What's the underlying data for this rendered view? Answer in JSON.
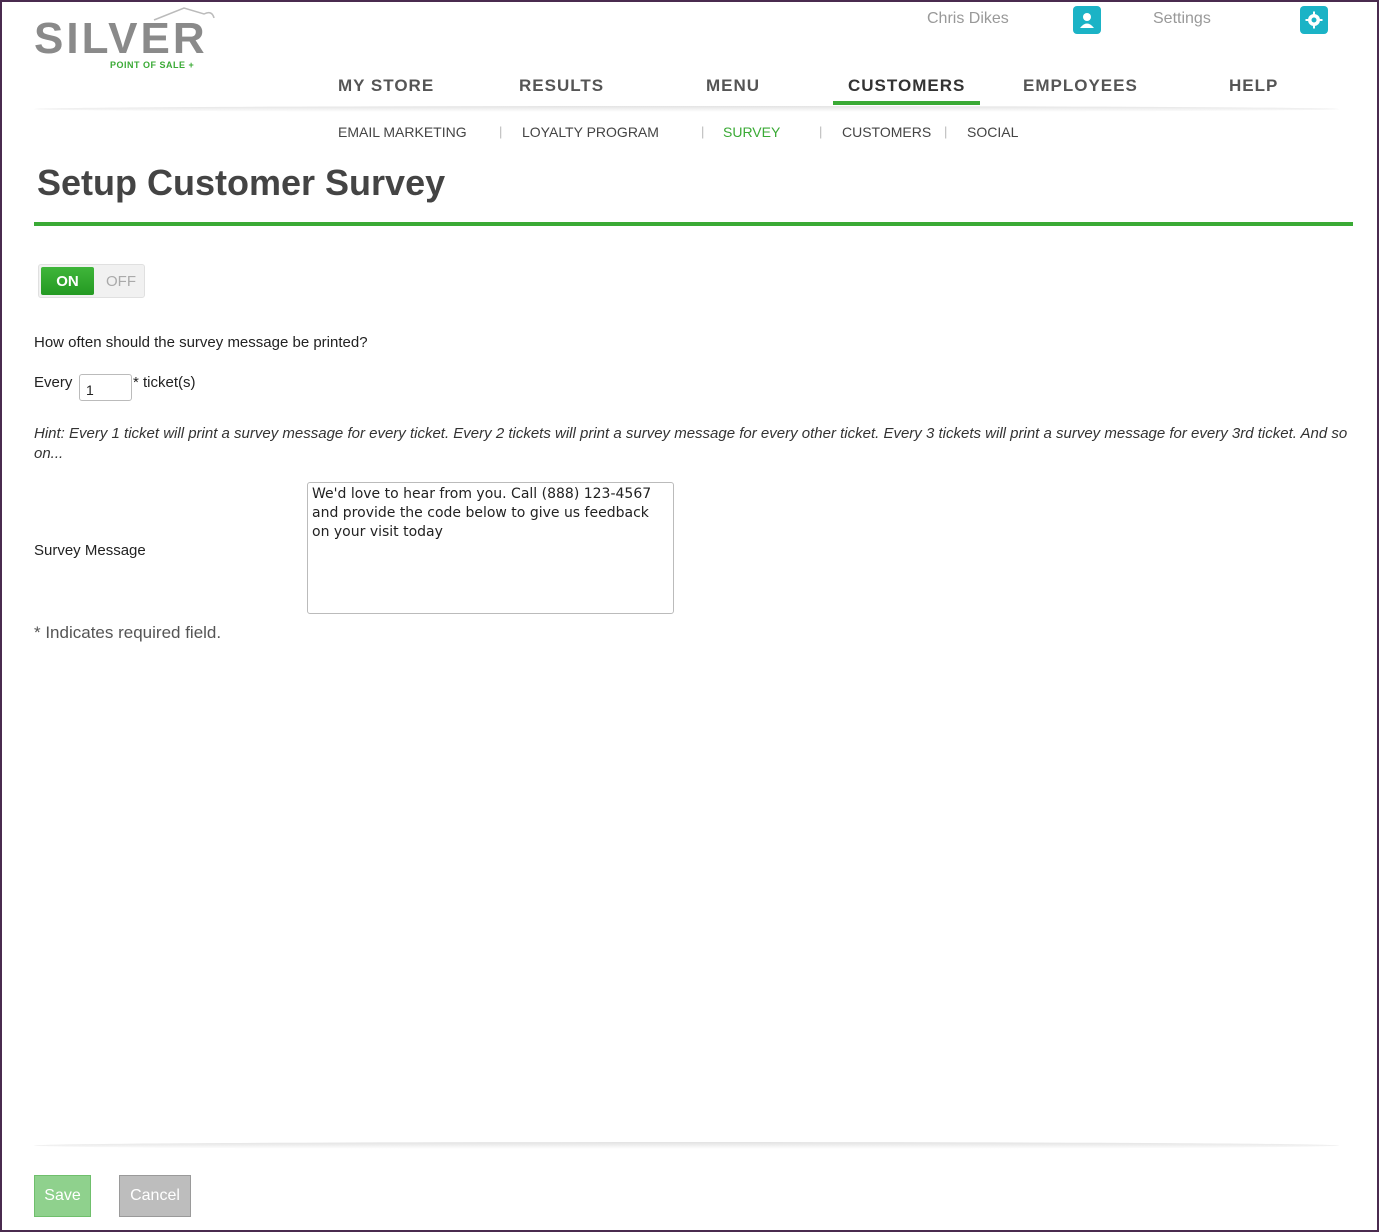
{
  "brand": {
    "name": "SILVER",
    "tagline": "POINT OF SALE +"
  },
  "header": {
    "user_name": "Chris Dikes",
    "settings_label": "Settings"
  },
  "main_nav": [
    {
      "label": "MY STORE",
      "active": false
    },
    {
      "label": "RESULTS",
      "active": false
    },
    {
      "label": "MENU",
      "active": false
    },
    {
      "label": "CUSTOMERS",
      "active": true
    },
    {
      "label": "EMPLOYEES",
      "active": false
    },
    {
      "label": "HELP",
      "active": false
    }
  ],
  "sub_nav": [
    {
      "label": "EMAIL MARKETING",
      "active": false
    },
    {
      "label": "LOYALTY PROGRAM",
      "active": false
    },
    {
      "label": "SURVEY",
      "active": true
    },
    {
      "label": "CUSTOMERS",
      "active": false
    },
    {
      "label": "SOCIAL",
      "active": false
    }
  ],
  "page": {
    "title": "Setup Customer Survey",
    "toggle": {
      "on_label": "ON",
      "off_label": "OFF",
      "state": "on"
    },
    "question": "How often should the survey message be printed?",
    "every_label": "Every",
    "every_value": "1",
    "tickets_label": "* ticket(s)",
    "hint": "Hint: Every 1 ticket will print a survey message for every ticket. Every 2 tickets will print a survey message for every other ticket. Every 3 tickets will print a survey message for every 3rd ticket. And so on...",
    "survey_label": "Survey Message",
    "survey_message": "We'd love to hear from you. Call (888) 123-4567 and provide the code below to give us feedback on your visit today",
    "required_note": "* Indicates required field."
  },
  "footer": {
    "save_label": "Save",
    "cancel_label": "Cancel"
  },
  "colors": {
    "accent": "#3aaa35",
    "icon": "#1bb3c6",
    "logo": "#8a8a8a"
  }
}
